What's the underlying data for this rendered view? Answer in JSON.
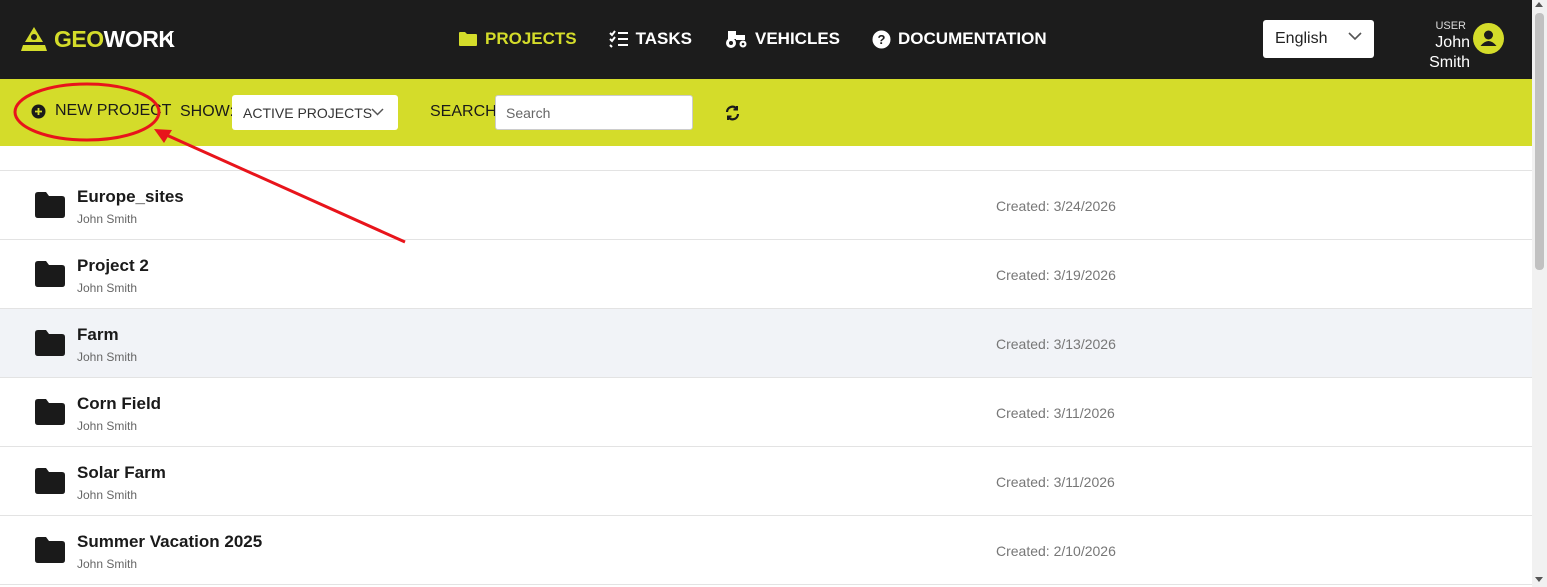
{
  "app": {
    "logo_geo": "GEO",
    "logo_work": "WORK",
    "accent_color": "#d4dc2a",
    "header_bg": "#1c1c1c"
  },
  "nav": {
    "items": [
      {
        "label": "PROJECTS",
        "icon": "folder-icon",
        "active": true
      },
      {
        "label": "TASKS",
        "icon": "checklist-icon",
        "active": false
      },
      {
        "label": "VEHICLES",
        "icon": "tractor-icon",
        "active": false
      },
      {
        "label": "DOCUMENTATION",
        "icon": "help-circle-icon",
        "active": false
      }
    ]
  },
  "language": {
    "selected": "English"
  },
  "user": {
    "role": "USER",
    "name": "John Smith",
    "icon": "user-circle-icon"
  },
  "toolbar": {
    "new_project_label": "NEW PROJECT",
    "show_label": "SHOW:",
    "show_selected": "ACTIVE PROJECTS",
    "search_label": "SEARCH:",
    "search_placeholder": "Search",
    "search_value": "",
    "refresh_icon": "refresh-icon"
  },
  "projects": [
    {
      "name": "Europe_sites",
      "owner": "John Smith",
      "created": "Created: 3/24/2026"
    },
    {
      "name": "Project 2",
      "owner": "John Smith",
      "created": "Created: 3/19/2026"
    },
    {
      "name": "Farm",
      "owner": "John Smith",
      "created": "Created: 3/13/2026"
    },
    {
      "name": "Corn Field",
      "owner": "John Smith",
      "created": "Created: 3/11/2026"
    },
    {
      "name": "Solar Farm",
      "owner": "John Smith",
      "created": "Created: 3/11/2026"
    },
    {
      "name": "Summer Vacation 2025",
      "owner": "John Smith",
      "created": "Created: 2/10/2026"
    }
  ],
  "annotation": {
    "color": "#e8141b",
    "shape": "ellipse-with-arrow",
    "target": "new-project-button"
  }
}
